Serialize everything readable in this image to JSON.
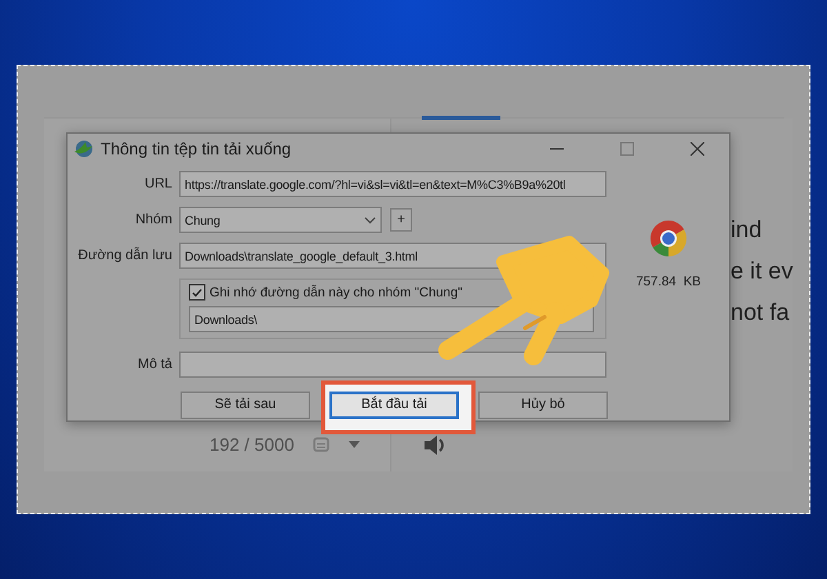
{
  "dialog": {
    "title": "Thông tin tệp tin tải xuống",
    "fields": [
      {
        "label": "URL",
        "kind": "text",
        "value": "https://translate.google.com/?hl=vi&sl=vi&tl=en&text=M%C3%B9a%20tl"
      },
      {
        "label": "Nhóm",
        "kind": "dropdown",
        "value": "Chung",
        "button": "+"
      },
      {
        "label": "Đường dẫn lưu",
        "kind": "text",
        "value": "Downloads\\translate_google_default_3.html"
      }
    ],
    "remember": {
      "label": "Ghi nhớ đường dẫn này cho nhóm \"Chung\"",
      "checked": true,
      "value": "Downloads\\"
    },
    "description": {
      "label": "Mô tả"
    },
    "file_size": "757.84  KB",
    "buttons": [
      {
        "label": "Sẽ tải sau",
        "highlighted": false
      },
      {
        "label": "Bắt đầu tải",
        "highlighted": true
      },
      {
        "label": "Hủy bỏ",
        "highlighted": false
      }
    ]
  },
  "background": {
    "texts": [
      "ind",
      "e it ev",
      "not fa"
    ],
    "counter": "192 / 5000"
  }
}
